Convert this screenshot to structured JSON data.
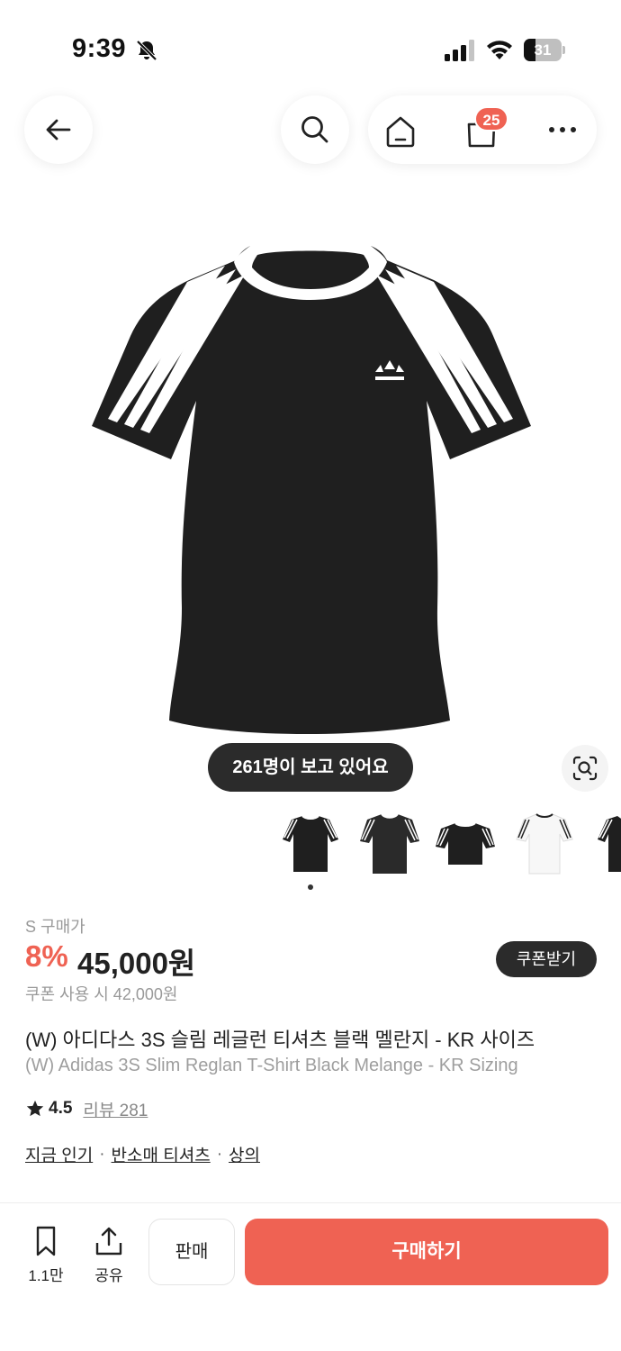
{
  "status_bar": {
    "time": "9:39",
    "battery_level": "31",
    "icons": [
      "bell-muted-icon",
      "cellular-signal-icon",
      "wifi-icon",
      "battery-icon"
    ]
  },
  "nav": {
    "back_icon": "arrow-left-icon",
    "search_icon": "search-icon",
    "home_icon": "home-icon",
    "bag_icon": "shopping-bag-icon",
    "cart_count": "25",
    "more_icon": "more-dots-icon"
  },
  "product_image": {
    "viewers_text": "261명이 보고 있어요",
    "lens_icon": "lens-search-icon",
    "thumbnail_count": 5,
    "active_thumbnail": 1
  },
  "price": {
    "size_label": "S 구매가",
    "discount": "8%",
    "amount": "45,000원",
    "coupon_button": "쿠폰받기",
    "coupon_price": "쿠폰 사용 시 42,000원"
  },
  "product": {
    "title_ko": "(W) 아디다스 3S 슬림 레글런 티셔츠 블랙 멜란지 - KR 사이즈",
    "title_en": "(W) Adidas 3S Slim Reglan T-Shirt Black Melange - KR Sizing",
    "rating": "4.5",
    "review_label": "리뷰 281",
    "categories": [
      "지금 인기",
      "반소매 티셔츠",
      "상의"
    ],
    "separator": "·"
  },
  "bottom_bar": {
    "bookmark_count": "1.1만",
    "share_label": "공유",
    "sell_label": "판매",
    "buy_label": "구매하기"
  },
  "colors": {
    "accent": "#ef6253",
    "dark_pill": "#2b2b2b",
    "muted_text": "#999999"
  }
}
